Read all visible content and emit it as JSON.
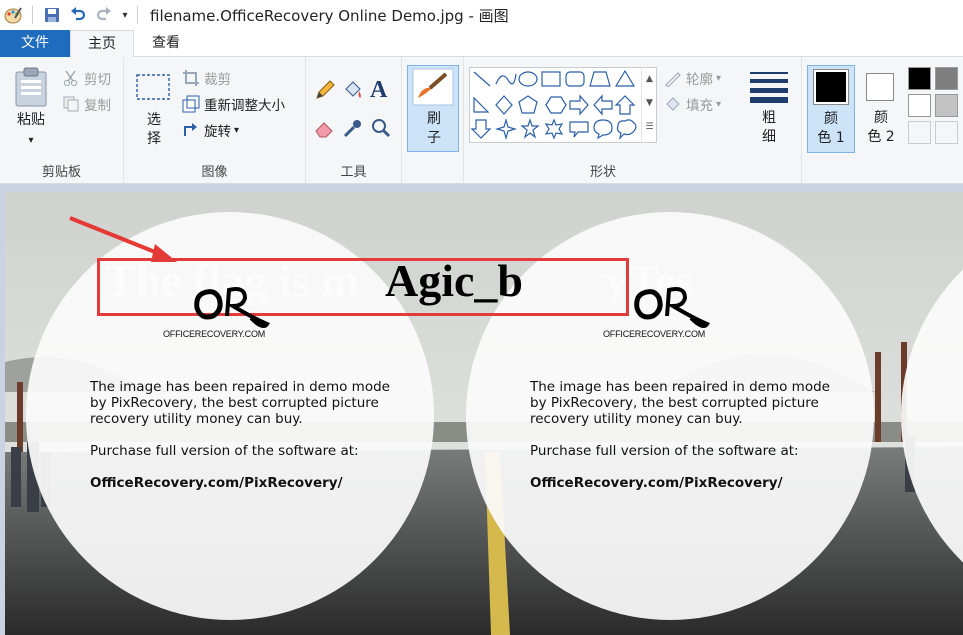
{
  "window": {
    "title": "filename.OfficeRecovery Online Demo.jpg - 画图"
  },
  "tabs": {
    "file": "文件",
    "home": "主页",
    "view": "查看"
  },
  "ribbon": {
    "clipboard": {
      "label": "剪贴板",
      "paste": "粘贴",
      "cut": "剪切",
      "copy": "复制"
    },
    "image": {
      "label": "图像",
      "select": "选\n择",
      "crop": "裁剪",
      "resize": "重新调整大小",
      "rotate": "旋转"
    },
    "tools": {
      "label": "工具"
    },
    "brushes": {
      "label": "刷\n子"
    },
    "shapes": {
      "label": "形状",
      "outline": "轮廓",
      "fill": "填充"
    },
    "size": {
      "label": "粗\n细"
    },
    "color1": "颜\n色 1",
    "color2": "颜\n色 2",
    "palette": [
      "#000000",
      "#7f7f7f",
      "#ffffff",
      "#c3c3c3",
      "#ffffff",
      "#ffffff"
    ]
  },
  "canvas": {
    "flag_text": "Agic_b",
    "faded_text": "The flag is m",
    "faded_tail": "yTes",
    "logo_caption": "OFFICERECOVERY.COM",
    "demo_line1": "The image has been repaired in demo mode",
    "demo_line2": "by PixRecovery, the best corrupted picture",
    "demo_line3": "recovery utility money can buy.",
    "purchase": "Purchase full version of the software at:",
    "url": "OfficeRecovery.com/PixRecovery/"
  }
}
